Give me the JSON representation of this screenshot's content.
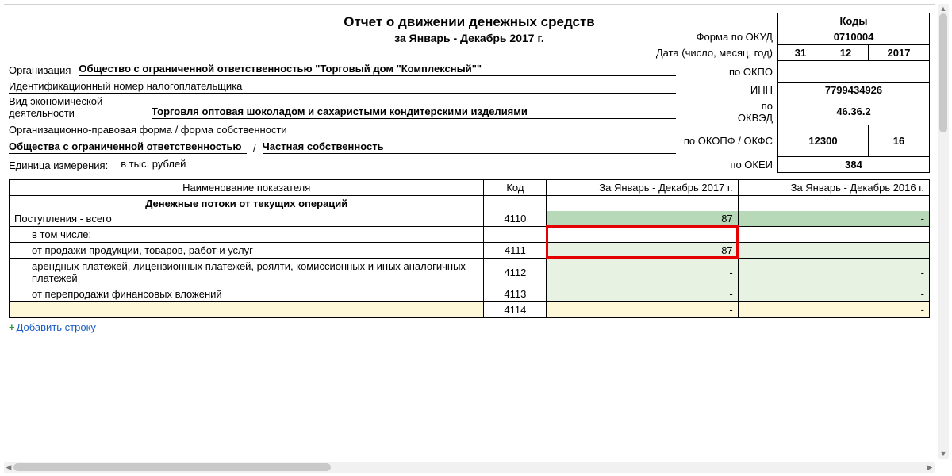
{
  "title": "Отчет о движении денежных средств",
  "subtitle": "за Январь - Декабрь 2017 г.",
  "codes": {
    "header": "Коды",
    "okud_label": "Форма по ОКУД",
    "okud": "0710004",
    "date_label": "Дата (число, месяц, год)",
    "date_day": "31",
    "date_month": "12",
    "date_year": "2017",
    "okpo_label": "по ОКПО",
    "okpo": "",
    "inn_label": "ИНН",
    "inn": "7799434926",
    "okved_label": "по\nОКВЭД",
    "okved": "46.36.2",
    "okopf_label": "по ОКОПФ / ОКФС",
    "okopf": "12300",
    "okfs": "16",
    "okei_label": "по ОКЕИ",
    "okei": "384"
  },
  "meta": {
    "org_label": "Организация",
    "org_value": "Общество с ограниченной ответственностью \"Торговый дом \"Комплексный\"\"",
    "inn_label": "Идентификационный номер налогоплательщика",
    "activity_label": "Вид экономической деятельности",
    "activity_value": "Торговля оптовая шоколадом и сахаристыми кондитерскими изделиями",
    "legal_form_label": "Организационно-правовая форма / форма собственности",
    "legal_form_value1": "Общества с ограниченной ответственностью",
    "legal_form_sep": "/",
    "legal_form_value2": "Частная собственность",
    "unit_label": "Единица измерения:",
    "unit_value": "в тыс. рублей"
  },
  "table": {
    "headers": {
      "name": "Наименование показателя",
      "code": "Код",
      "period1": "За Январь - Декабрь 2017 г.",
      "period2": "За Январь - Декабрь 2016 г."
    },
    "section1_title": "Денежные потоки от текущих операций",
    "rows": [
      {
        "name": "Поступления - всего",
        "code": "4110",
        "v1": "87",
        "v2": "-",
        "indent": 0,
        "style1": "bg-green-dark",
        "style2": "bg-green-dark"
      },
      {
        "name": "в том числе:",
        "code": "",
        "v1": "",
        "v2": "",
        "indent": 1,
        "style1": "",
        "style2": "",
        "merge_next": true
      },
      {
        "name": "от продажи продукции, товаров, работ и услуг",
        "code": "4111",
        "v1": "87",
        "v2": "-",
        "indent": 1,
        "style1": "bg-green-light",
        "style2": "bg-green-light",
        "highlight": true
      },
      {
        "name": "арендных платежей, лицензионных платежей, роялти, комиссионных и иных аналогичных платежей",
        "code": "4112",
        "v1": "-",
        "v2": "-",
        "indent": 1,
        "style1": "bg-green-light",
        "style2": "bg-green-light"
      },
      {
        "name": "от перепродажи финансовых вложений",
        "code": "4113",
        "v1": "-",
        "v2": "-",
        "indent": 1,
        "style1": "bg-green-light",
        "style2": "bg-green-light"
      },
      {
        "name": "",
        "code": "4114",
        "v1": "-",
        "v2": "-",
        "indent": 1,
        "style1": "bg-yellow",
        "style2": "bg-yellow",
        "name_style": "bg-yellow"
      }
    ]
  },
  "add_row_label": "Добавить строку"
}
